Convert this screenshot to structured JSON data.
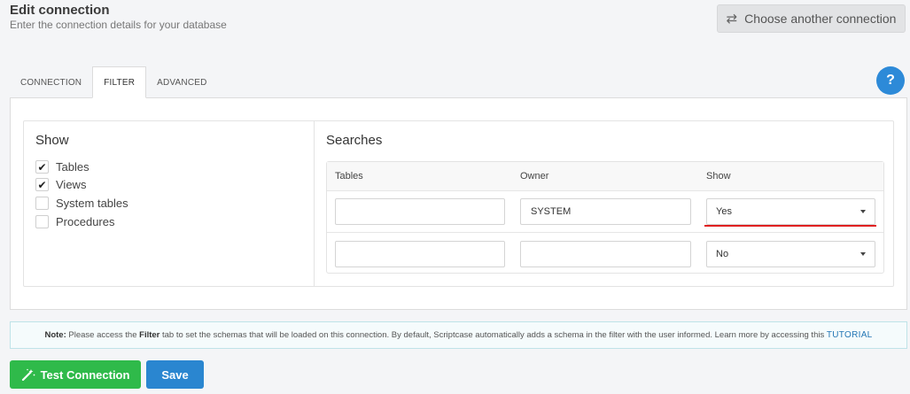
{
  "header": {
    "title": "Edit connection",
    "subtitle": "Enter the connection details for your database",
    "choose_button_icon": "arrows-swap-icon",
    "choose_button_label": "Choose another connection"
  },
  "tabs": [
    {
      "label": "CONNECTION",
      "active": false
    },
    {
      "label": "FILTER",
      "active": true
    },
    {
      "label": "ADVANCED",
      "active": false
    }
  ],
  "help_label": "?",
  "show": {
    "title": "Show",
    "items": [
      {
        "label": "Tables",
        "checked": true,
        "mark": "✔"
      },
      {
        "label": "Views",
        "checked": true,
        "mark": "✔"
      },
      {
        "label": "System tables",
        "checked": false,
        "mark": ""
      },
      {
        "label": "Procedures",
        "checked": false,
        "mark": ""
      }
    ]
  },
  "searches": {
    "title": "Searches",
    "columns": [
      "Tables",
      "Owner",
      "Show"
    ],
    "rows": [
      {
        "tables": "",
        "owner": "SYSTEM",
        "show": "Yes"
      },
      {
        "tables": "",
        "owner": "",
        "show": "No"
      }
    ]
  },
  "note": {
    "label": "Note:",
    "text_before": " Please access the ",
    "filter_word": "Filter",
    "text_after": " tab to set the schemas that will be loaded on this connection. By default, Scriptcase automatically adds a schema in the filter with the user informed. Learn more by accessing this ",
    "link": "TUTORIAL"
  },
  "actions": {
    "test_label": "Test Connection",
    "test_icon": "magic-wand-icon",
    "save_label": "Save"
  },
  "colors": {
    "accent_blue": "#2a86d0",
    "success_green": "#2fba4a",
    "highlight_red": "#e02020"
  }
}
